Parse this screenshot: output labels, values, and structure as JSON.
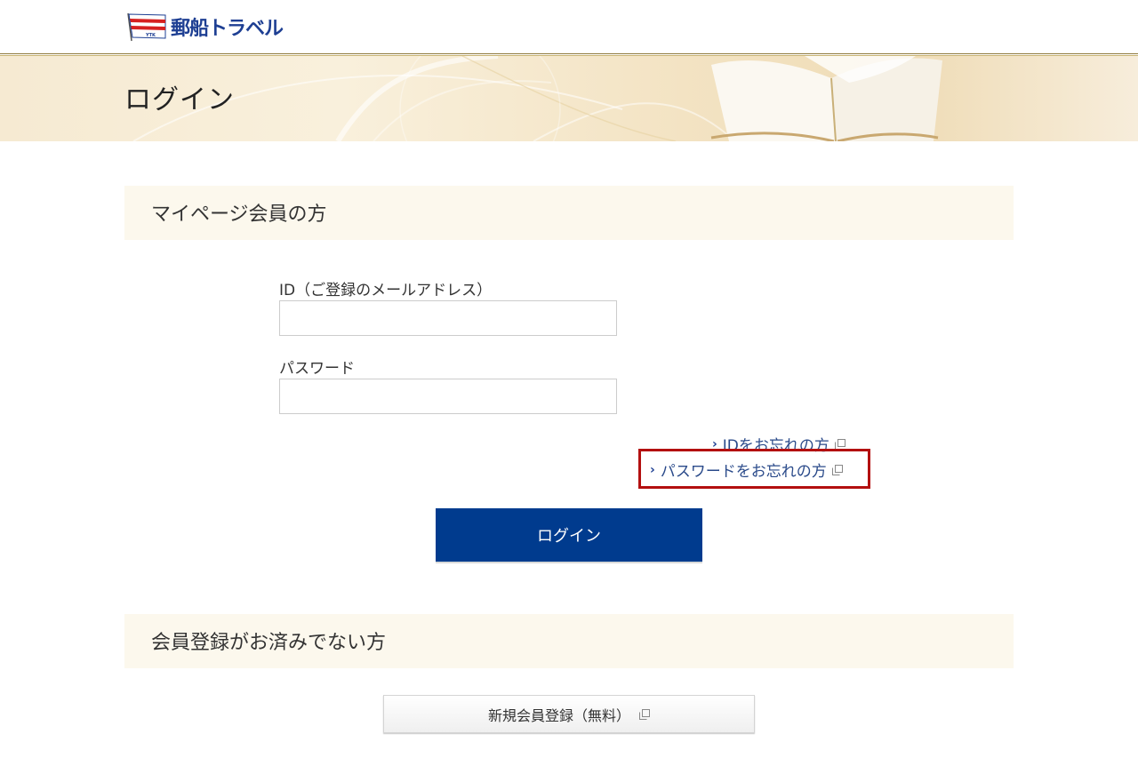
{
  "header": {
    "logo_text": "郵船トラベル",
    "logo_flag_text": "YTK"
  },
  "banner": {
    "title": "ログイン"
  },
  "member_section": {
    "title": "マイページ会員の方",
    "id_label": "ID（ご登録のメールアドレス）",
    "id_value": "",
    "password_label": "パスワード",
    "password_value": "",
    "forgot_id_link": "IDをお忘れの方",
    "forgot_password_link": "パスワードをお忘れの方",
    "login_button": "ログイン"
  },
  "register_section": {
    "title": "会員登録がお済みでない方",
    "register_button": "新規会員登録（無料）"
  },
  "colors": {
    "brand_blue": "#003b8e",
    "link_blue": "#2a4a8a",
    "highlight_red": "#b31010",
    "section_bg": "#fcf8ed"
  }
}
